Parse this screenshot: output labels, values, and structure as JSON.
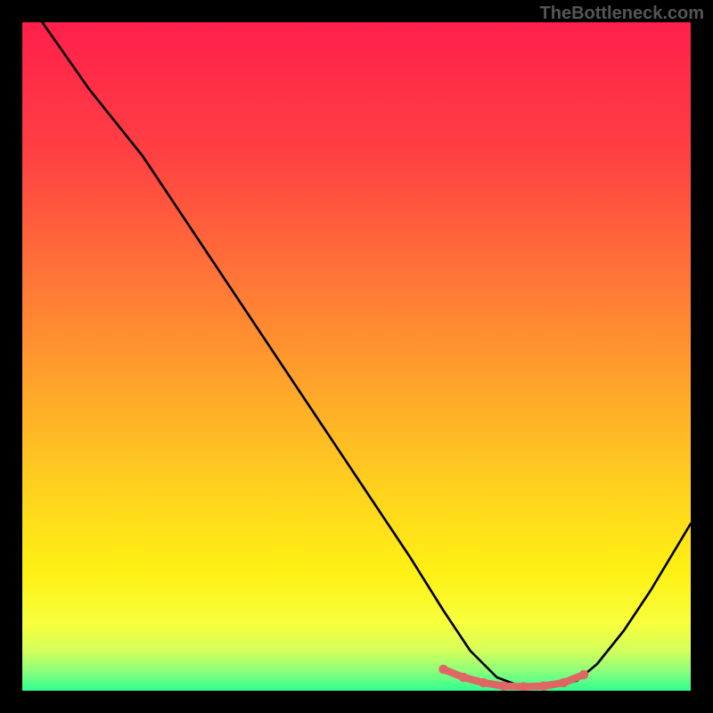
{
  "watermark": {
    "text": "TheBottleneck.com"
  },
  "chart_data": {
    "type": "line",
    "title": "",
    "xlabel": "",
    "ylabel": "",
    "xlim": [
      0,
      100
    ],
    "ylim": [
      0,
      100
    ],
    "grid": false,
    "legend": false,
    "series": [
      {
        "name": "bottleneck-curve",
        "color": "#000000",
        "x": [
          3,
          10,
          18,
          26,
          34,
          42,
          50,
          58,
          63,
          67,
          71,
          75,
          79,
          83,
          86,
          90,
          94,
          100
        ],
        "y": [
          100,
          90,
          80,
          68,
          56,
          44,
          32,
          20,
          12,
          6,
          2,
          0.5,
          0.5,
          1.5,
          4,
          9,
          15,
          25
        ]
      },
      {
        "name": "optimal-range-marker",
        "color": "#e06666",
        "x": [
          63,
          66,
          69,
          72,
          75,
          78,
          81,
          84
        ],
        "y": [
          3.2,
          2.0,
          1.2,
          0.7,
          0.6,
          0.7,
          1.2,
          2.4
        ]
      }
    ],
    "background_gradient_stops": [
      {
        "offset": 0.0,
        "color": "#ff1f4b"
      },
      {
        "offset": 0.2,
        "color": "#ff4142"
      },
      {
        "offset": 0.4,
        "color": "#ff7a36"
      },
      {
        "offset": 0.55,
        "color": "#ffa62a"
      },
      {
        "offset": 0.7,
        "color": "#ffd21e"
      },
      {
        "offset": 0.82,
        "color": "#fff014"
      },
      {
        "offset": 0.9,
        "color": "#f7ff3d"
      },
      {
        "offset": 0.94,
        "color": "#d4ff5a"
      },
      {
        "offset": 0.97,
        "color": "#8dff7a"
      },
      {
        "offset": 1.0,
        "color": "#2fff8f"
      }
    ]
  }
}
